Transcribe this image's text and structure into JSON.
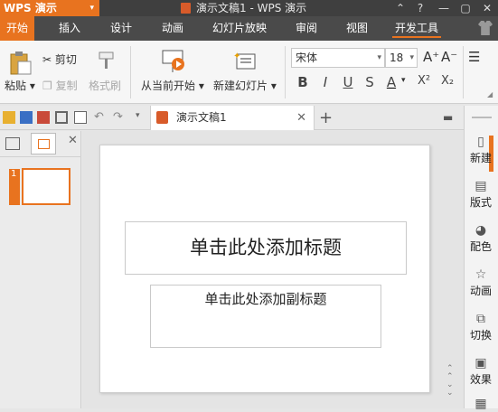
{
  "app": {
    "name": "WPS 演示"
  },
  "window": {
    "title": "演示文稿1 - WPS 演示",
    "help_label": "?"
  },
  "tabs": [
    "开始",
    "插入",
    "设计",
    "动画",
    "幻灯片放映",
    "审阅",
    "视图",
    "开发工具"
  ],
  "ribbon": {
    "paste": "粘贴",
    "cut": "剪切",
    "copy": "复制",
    "format_painter": "格式刷",
    "from_current": "从当前开始",
    "new_slide": "新建幻灯片",
    "font_name": "宋体",
    "font_size": "18",
    "grow_font": "A⁺",
    "shrink_font": "A⁻",
    "bold": "B",
    "italic": "I",
    "underline": "U",
    "strike": "S",
    "font_color": "A",
    "superscript": "X²",
    "subscript": "X₂"
  },
  "doc_tab": {
    "label": "演示文稿1"
  },
  "slide": {
    "number": "1",
    "title_placeholder": "单击此处添加标题",
    "subtitle_placeholder": "单击此处添加副标题"
  },
  "task_pane": [
    "新建",
    "版式",
    "配色",
    "动画",
    "切换",
    "效果"
  ],
  "colors": {
    "accent": "#e8731f",
    "dark_bar": "#3f3f3f"
  }
}
